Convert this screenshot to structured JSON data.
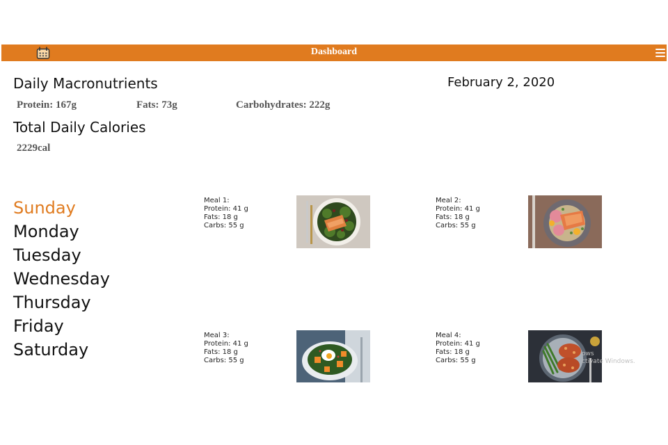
{
  "header": {
    "title": "Dashboard",
    "menu_icon": "hamburger-icon",
    "app_icon": "calendar-icon",
    "bar_color": "#e07b1f"
  },
  "macros": {
    "heading": "Daily Macronutrients",
    "protein": "Protein: 167g",
    "fats": "Fats: 73g",
    "carbs": "Carbohydrates: 222g"
  },
  "date": "February 2, 2020",
  "calories": {
    "heading": "Total Daily Calories",
    "value": "2229cal"
  },
  "days": [
    {
      "label": "Sunday",
      "active": true
    },
    {
      "label": "Monday",
      "active": false
    },
    {
      "label": "Tuesday",
      "active": false
    },
    {
      "label": "Wednesday",
      "active": false
    },
    {
      "label": "Thursday",
      "active": false
    },
    {
      "label": "Friday",
      "active": false
    },
    {
      "label": "Saturday",
      "active": false
    }
  ],
  "meals": [
    {
      "title": "Meal 1:",
      "protein": "Protein: 41 g",
      "fats": "Fats: 18 g",
      "carbs": "Carbs: 55 g",
      "image": "salmon-kale-plate"
    },
    {
      "title": "Meal 2:",
      "protein": "Protein: 41 g",
      "fats": "Fats: 18 g",
      "carbs": "Carbs: 55 g",
      "image": "salmon-citrus-quinoa-plate"
    },
    {
      "title": "Meal 3:",
      "protein": "Protein: 41 g",
      "fats": "Fats: 18 g",
      "carbs": "Carbs: 55 g",
      "image": "kale-squash-egg-bowl"
    },
    {
      "title": "Meal 4:",
      "protein": "Protein: 41 g",
      "fats": "Fats: 18 g",
      "carbs": "Carbs: 55 g",
      "image": "chicken-green-beans-plate"
    }
  ],
  "watermark": {
    "line1": "ows",
    "line2": "ctivate Windows."
  }
}
